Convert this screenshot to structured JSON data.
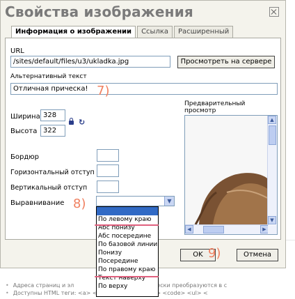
{
  "dialog": {
    "title": "Свойства изображения",
    "tabs": [
      "Информация о изображении",
      "Ссылка",
      "Расширенный"
    ]
  },
  "url": {
    "label": "URL",
    "value": "/sites/default/files/u3/ukladka.jpg",
    "browse_button": "Просмотреть на сервере"
  },
  "alt": {
    "label": "Альтернативный текст",
    "value": "Отличная прическа!"
  },
  "size": {
    "width_label": "Ширина",
    "width_value": "328",
    "height_label": "Высота",
    "height_value": "322"
  },
  "fields": {
    "border_label": "Бордюр",
    "hspace_label": "Горизонтальный отступ",
    "vspace_label": "Вертикальный отступ",
    "align_label": "Выравнивание"
  },
  "preview": {
    "label": "Предварительный просмотр"
  },
  "align_options": [
    "",
    "По левому краю",
    "Абс понизу",
    "Абс посередине",
    "По базовой линии",
    "Понизу",
    "Посередине",
    "По правому краю",
    "Текст наверху",
    "По верху"
  ],
  "buttons": {
    "ok": "OK",
    "cancel": "Отмена"
  },
  "annotations": {
    "seven": "7)",
    "eight": "8)",
    "nine": "9)"
  },
  "background_text": {
    "line1": "Адреса страниц и эл",
    "line1_tail": "томатически преобразуются в с",
    "line2": "Доступны HTML теги: <a> <em> <strong> <cite> <code> <ul> <"
  },
  "colors": {
    "annotation": "#f08060",
    "highlight_underline": "#e0607e",
    "selected_option": "#316ac5"
  }
}
